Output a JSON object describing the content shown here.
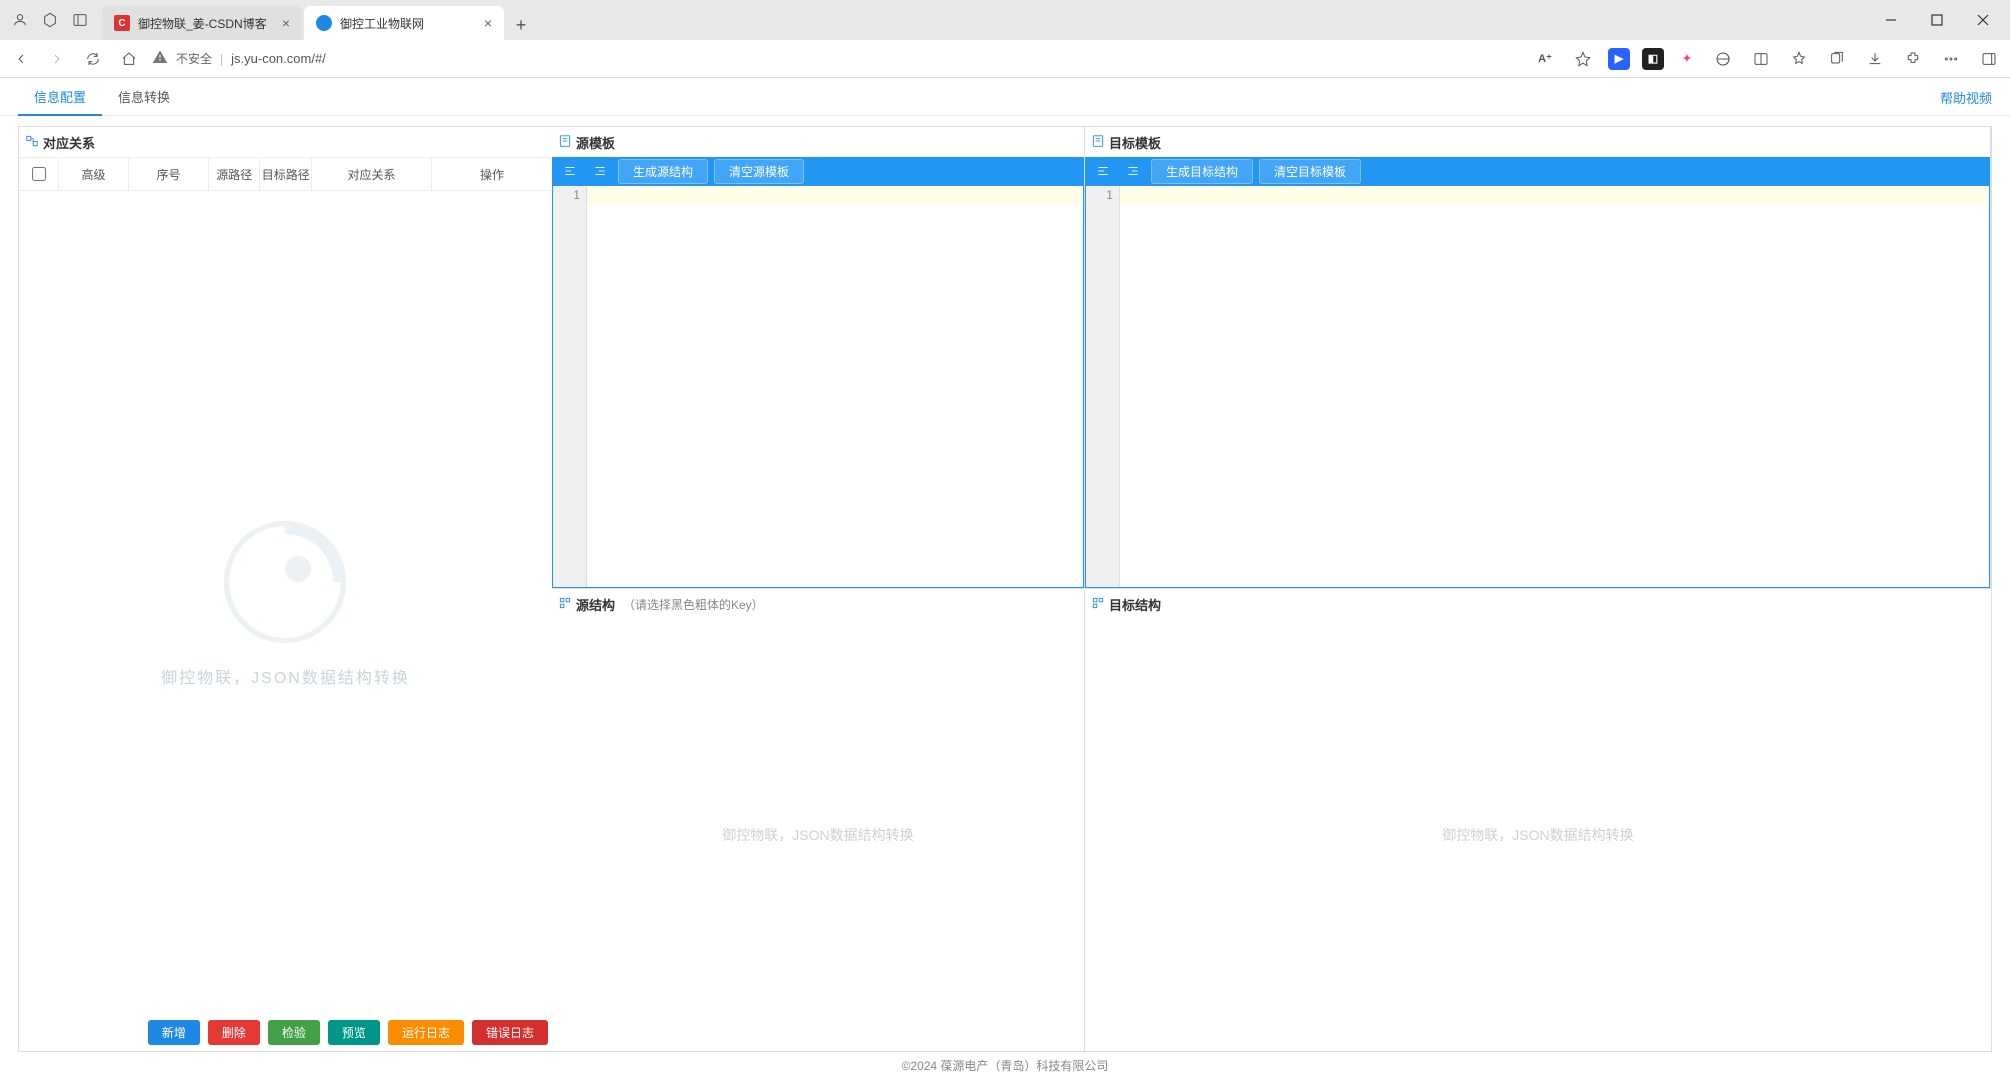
{
  "browser": {
    "tabs": [
      {
        "favColor": "#d33",
        "favLetter": "C",
        "title": "御控物联_姜-CSDN博客",
        "active": false
      },
      {
        "favColor": "#1e88e5",
        "favLetter": "",
        "title": "御控工业物联网",
        "active": true
      }
    ],
    "url": "js.yu-con.com/#/",
    "insecure": "不安全"
  },
  "pageTabs": {
    "config": "信息配置",
    "convert": "信息转换",
    "help": "帮助视频"
  },
  "panels": {
    "srcTpl": {
      "title": "源模板",
      "btnGen": "生成源结构",
      "btnClear": "清空源模板",
      "line": "1"
    },
    "dstTpl": {
      "title": "目标模板",
      "btnGen": "生成目标结构",
      "btnClear": "清空目标模板",
      "line": "1"
    },
    "srcStruct": {
      "title": "源结构",
      "hint": "（请选择黑色粗体的Key）",
      "watermark": "御控物联，JSON数据结构转换"
    },
    "dstStruct": {
      "title": "目标结构",
      "watermark": "御控物联，JSON数据结构转换"
    },
    "relation": {
      "title": "对应关系",
      "cols": {
        "adv": "高级",
        "idx": "序号",
        "src": "源路径",
        "dst": "目标路径",
        "rel": "对应关系",
        "op": "操作"
      },
      "watermark": "御控物联，JSON数据结构转换",
      "buttons": {
        "add": "新增",
        "del": "删除",
        "check": "检验",
        "preview": "预览",
        "runlog": "运行日志",
        "errlog": "错误日志"
      }
    }
  },
  "footer": "©2024 葆源电产（青岛）科技有限公司"
}
